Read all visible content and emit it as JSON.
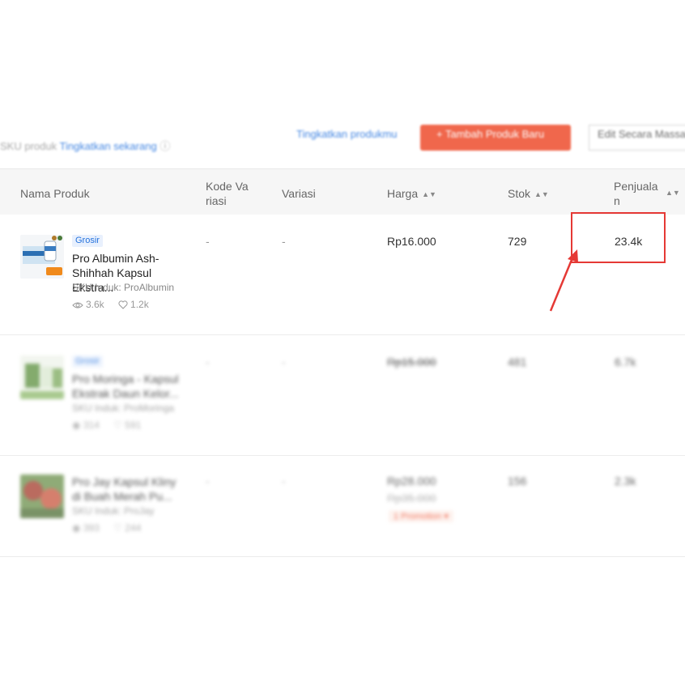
{
  "topbar": {
    "note_text": "SKU produk",
    "note_link": "Tingkatkan sekarang",
    "upgrade_link": "Tingkatkan produkmu",
    "add_button": "+ Tambah Produk Baru",
    "mass_button": "Edit Secara Massal"
  },
  "table": {
    "columns": [
      "Nama Produk",
      "Kode Va riasi",
      "Variasi",
      "Harga",
      "Stok",
      "Penjualan"
    ],
    "rows": [
      {
        "badge": "Grosir",
        "name": "Pro Albumin Ash-Shihhah Kapsul Ekstra...",
        "sku": "SKU Induk: ProAlbumin",
        "views": "3.6k",
        "likes": "1.2k",
        "variant_code": "-",
        "variant": "-",
        "price": "Rp16.000",
        "stock": "729",
        "sales": "23.4k"
      },
      {
        "badge": "Grosir",
        "name": "Pro Moringa - Kapsul Ekstrak Daun Kelor...",
        "sku": "SKU Induk: ProMoringa",
        "views": "314",
        "likes": "591",
        "variant_code": "-",
        "variant": "-",
        "price": "Rp15.000",
        "stock": "481",
        "sales": "6.7k"
      },
      {
        "badge": "",
        "name": "Pro Jay Kapsul Kliny di Buah Merah Pu...",
        "sku": "SKU Induk: ProJay",
        "views": "393",
        "likes": "244",
        "variant_code": "-",
        "variant": "-",
        "price": "Rp28.000",
        "price_original": "Rp35.000",
        "promotion": "1 Promotion",
        "stock": "156",
        "sales": "2.3k"
      }
    ]
  },
  "colors": {
    "accent": "#ee4d2d",
    "link": "#2673dd",
    "highlight": "#e53935"
  }
}
